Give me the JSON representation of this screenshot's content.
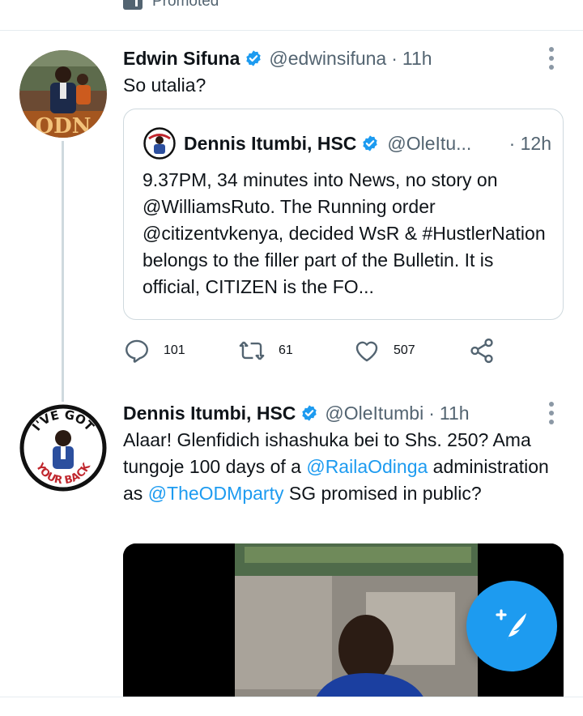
{
  "promoted": {
    "label": "Promoted"
  },
  "colors": {
    "accent": "#1d9bf0",
    "text": "#0f1419",
    "muted": "#536471",
    "border": "#cfd9de",
    "verified": "#1d9bf0"
  },
  "tweets": [
    {
      "name": "Edwin Sifuna",
      "verified": true,
      "handle": "@edwinsifuna",
      "dot": "·",
      "time": "11h",
      "text": "So utalia?",
      "avatar_icon": "profile-photo",
      "quote": {
        "name": "Dennis Itumbi, HSC",
        "verified": true,
        "handle": "@OleItu...",
        "time": "· 12h",
        "text": "9.37PM, 34 minutes into News, no story on @WilliamsRuto. The Running order @citizentvkenya, decided WsR & #HustlerNation belongs to the filler part of the Bulletin. It is official, CITIZEN is the FO..."
      },
      "actions": {
        "reply": {
          "icon": "reply-icon",
          "count": "101"
        },
        "retweet": {
          "icon": "retweet-icon",
          "count": "61"
        },
        "like": {
          "icon": "like-icon",
          "count": "507"
        },
        "share": {
          "icon": "share-icon"
        }
      }
    },
    {
      "name": "Dennis Itumbi, HSC",
      "verified": true,
      "handle": "@OleItumbi",
      "dot": "·",
      "time": "11h",
      "text_parts": [
        {
          "text": "Alaar! Glenfidich ishashuka bei to Shs. 250? Ama tungoje 100 days of a ",
          "mention": false
        },
        {
          "text": "@RailaOdinga",
          "mention": true
        },
        {
          "text": " administration as ",
          "mention": false
        },
        {
          "text": "@TheODMparty",
          "mention": true
        },
        {
          "text": " SG promised in public?",
          "mention": false
        }
      ],
      "avatar_text": {
        "top": "I'VE GOT",
        "bottom": "YOUR BACK"
      },
      "media_icon": "video-thumbnail"
    }
  ],
  "compose": {
    "icon": "compose-tweet-icon",
    "glyph": "+"
  }
}
